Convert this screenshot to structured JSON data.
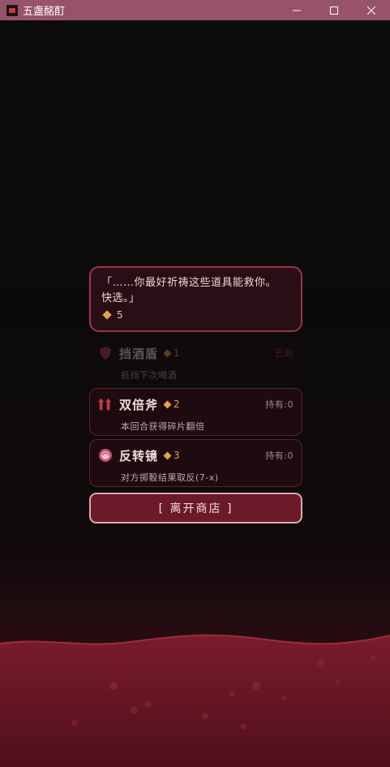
{
  "window": {
    "title": "五盏酩酊",
    "controls": {
      "minimize": "—",
      "maximize": "☐",
      "close": "✕"
    }
  },
  "dialog": {
    "line1": "「……你最好祈祷这些道具能救你。",
    "line2": "快选。」",
    "coins": "5"
  },
  "items": [
    {
      "name": "挡酒盾",
      "price": "1",
      "status": "已购",
      "desc": "抵挡下次喝酒",
      "icon": "shield-icon",
      "disabled": true
    },
    {
      "name": "双倍斧",
      "price": "2",
      "status": "持有:0",
      "desc": "本回合获得碎片翻倍",
      "icon": "double-arrow-icon",
      "disabled": false
    },
    {
      "name": "反转镜",
      "price": "3",
      "status": "持有:0",
      "desc": "对方掷骰结果取反(7-x)",
      "icon": "mirror-icon",
      "disabled": false
    }
  ],
  "leave_button": "[ 离开商店 ]",
  "colors": {
    "titlebar": "#97536a",
    "accent": "#9c3547",
    "price": "#e8a04a",
    "liquid": "#6b1a29"
  }
}
